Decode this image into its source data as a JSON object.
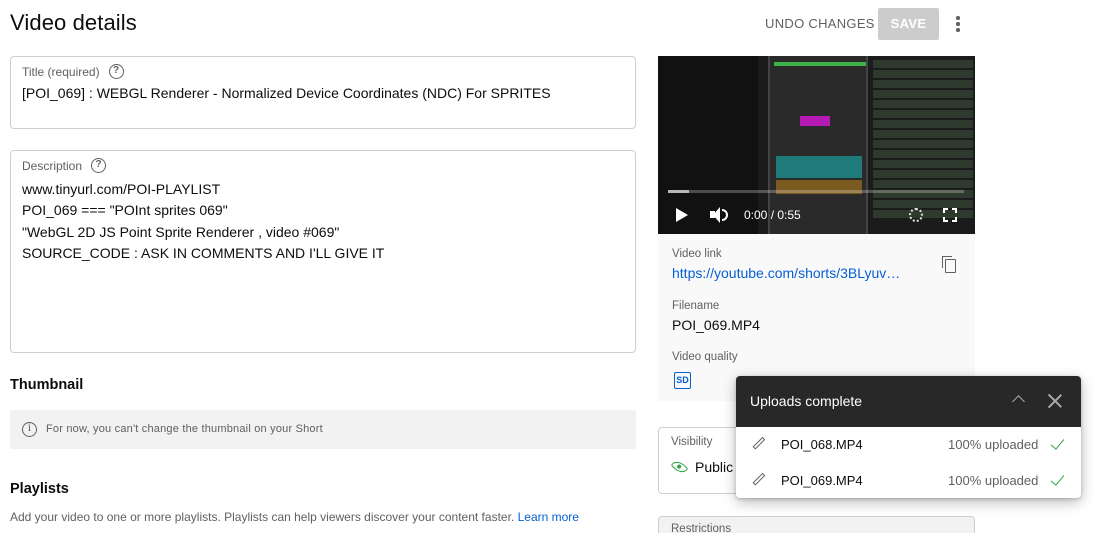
{
  "header": {
    "title": "Video details",
    "undo_label": "UNDO CHANGES",
    "save_label": "SAVE",
    "more_icon": "more-vert-icon"
  },
  "title_field": {
    "label": "Title (required)",
    "value": "[POI_069] : WEBGL Renderer - Normalized Device Coordinates (NDC) For SPRITES"
  },
  "description_field": {
    "label": "Description",
    "lines": [
      "www.tinyurl.com/POI-PLAYLIST",
      "POI_069 === \"POInt sprites 069\"",
      "\"WebGL 2D JS Point Sprite Renderer , video #069\"",
      "SOURCE_CODE : ASK IN COMMENTS AND I'LL GIVE IT"
    ]
  },
  "thumbnail": {
    "heading": "Thumbnail",
    "note": "For now, you can't change the thumbnail on your Short"
  },
  "playlists": {
    "heading": "Playlists",
    "description": "Add your video to one or more playlists. Playlists can help viewers discover your content faster.",
    "learn_more": "Learn more"
  },
  "video_card": {
    "time": "0:00 / 0:55",
    "progress_loaded_fraction": 0.07,
    "video_link_label": "Video link",
    "video_link": "https://youtube.com/shorts/3BLyuv…",
    "filename_label": "Filename",
    "filename": "POI_069.MP4",
    "quality_label": "Video quality",
    "quality_badge": "SD",
    "accent_color": "#065fd4"
  },
  "visibility": {
    "label": "Visibility",
    "value": "Public",
    "status_color": "#2ba640"
  },
  "restrictions": {
    "label": "Restrictions"
  },
  "upload_toast": {
    "title": "Uploads complete",
    "items": [
      {
        "file": "POI_068.MP4",
        "status": "100% uploaded"
      },
      {
        "file": "POI_069.MP4",
        "status": "100% uploaded"
      }
    ]
  }
}
